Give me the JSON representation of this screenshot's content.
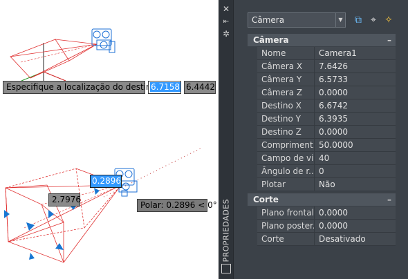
{
  "command_prompt": {
    "label": "Especifique a localização do destino:",
    "x_value": "6.7158",
    "y_value": "6.4442"
  },
  "grips": {
    "distance_value": "0.2896",
    "side_value": "2.7976",
    "polar_tooltip": "Polar: 0.2896 < 0°"
  },
  "palette": {
    "title": "PROPRIEDADES",
    "object_selector": "Câmera",
    "sections": [
      {
        "title": "Câmera",
        "collapse": "–",
        "rows": [
          {
            "name": "Nome",
            "value": "Camera1"
          },
          {
            "name": "Câmera X",
            "value": "7.6426"
          },
          {
            "name": "Câmera Y",
            "value": "6.5733"
          },
          {
            "name": "Câmera Z",
            "value": "0.0000"
          },
          {
            "name": "Destino X",
            "value": "6.6742"
          },
          {
            "name": "Destino Y",
            "value": "6.3935"
          },
          {
            "name": "Destino Z",
            "value": "0.0000"
          },
          {
            "name": "Compriment...",
            "value": "50.0000"
          },
          {
            "name": "Campo de vi...",
            "value": "40"
          },
          {
            "name": "Ângulo de r...",
            "value": "0"
          },
          {
            "name": "Plotar",
            "value": "Não"
          }
        ]
      },
      {
        "title": "Corte",
        "collapse": "–",
        "rows": [
          {
            "name": "Plano frontal",
            "value": "0.0000"
          },
          {
            "name": "Plano poster...",
            "value": "0.0000"
          },
          {
            "name": "Corte",
            "value": "Desativado"
          }
        ]
      }
    ]
  },
  "icons": {
    "close": "close-icon",
    "pin": "autohide-icon",
    "settings": "gear-icon",
    "quick_select": "quick-select-icon",
    "select_objects": "select-objects-icon",
    "toggle_pickadd": "toggle-pickadd-icon"
  },
  "colors": {
    "camera_blue": "#1b6fd6",
    "frustum_red": "#e03030",
    "grip_blue": "#1976d2",
    "palette_bg": "#3b4148"
  }
}
